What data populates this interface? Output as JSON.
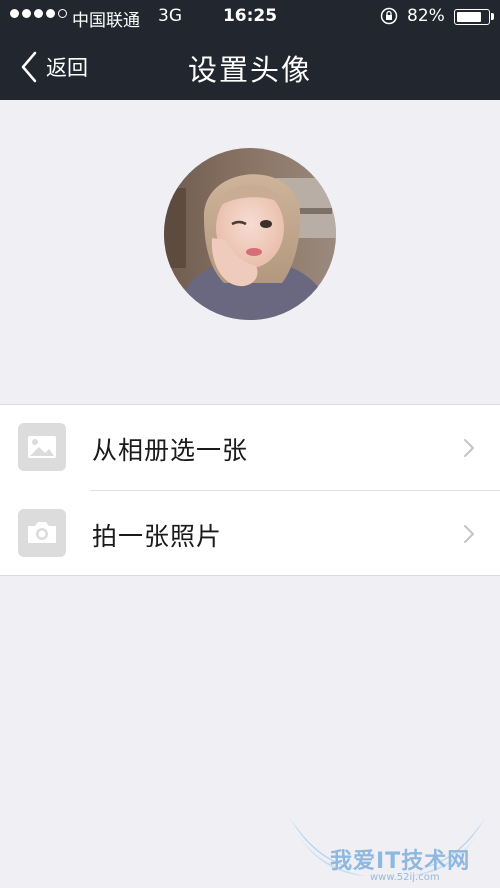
{
  "status_bar": {
    "carrier": "中国联通",
    "network": "3G",
    "time": "16:25",
    "battery_percent": "82%",
    "battery_level": 0.82
  },
  "nav": {
    "back_label": "返回",
    "title": "设置头像"
  },
  "options": [
    {
      "label": "从相册选一张",
      "icon": "image-icon"
    },
    {
      "label": "拍一张照片",
      "icon": "camera-icon"
    }
  ],
  "watermark": {
    "text": "我爱IT技术网",
    "url": "www.52ij.com"
  },
  "colors": {
    "header_bg": "#22262f",
    "page_bg": "#efeff4",
    "icon_bg": "#dcdcdc"
  }
}
